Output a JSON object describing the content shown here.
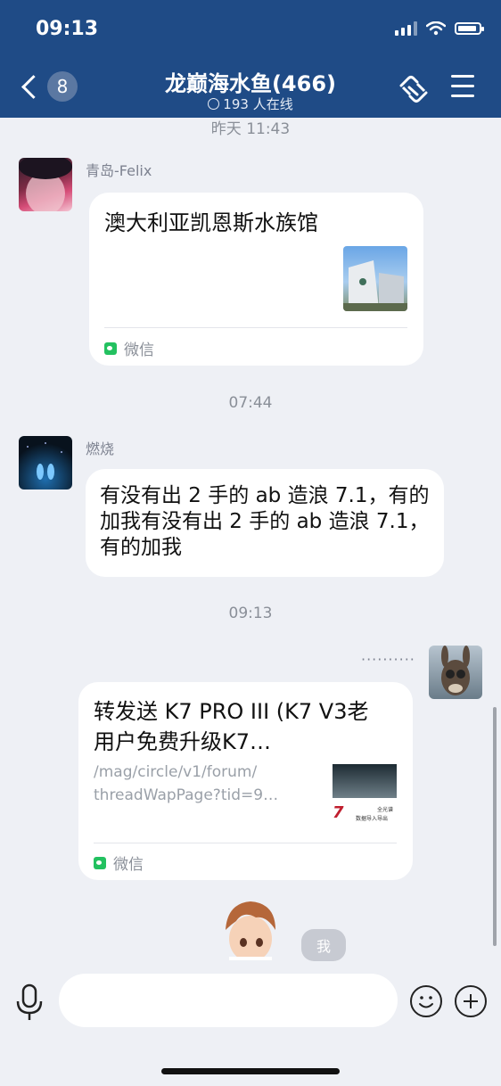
{
  "status_bar": {
    "time": "09:13"
  },
  "header": {
    "back_badge": "8",
    "title": "龙巅海水鱼(466)",
    "subtitle": "193 人在线"
  },
  "messages": {
    "ts1": "昨天 11:43",
    "m1": {
      "sender": "青岛-Felix",
      "card_title": "澳大利亚凯恩斯水族馆",
      "source": "微信"
    },
    "ts2": "07:44",
    "m2": {
      "sender": "燃烧",
      "lines": [
        "有没有出 2 手的 ab 造浪 7.1，有的",
        "加我有没有出 2 手的 ab 造浪 7.1，",
        "有的加我"
      ]
    },
    "ts3": "09:13",
    "m3": {
      "sender_dots": "··········",
      "card_title_lines": [
        "转发送 K7 PRO III (K7 V3老",
        "用户免费升级K7…"
      ],
      "url_lines": [
        "/mag/circle/v1/forum/",
        "threadWapPage?tid=9…"
      ],
      "thumb_text": [
        "7",
        "全光谱",
        "数据导入导出"
      ],
      "source": "微信"
    },
    "me_label": "我"
  },
  "colors": {
    "header_bg": "#1f4b86",
    "page_bg": "#eef0f5",
    "wechat_green": "#23c160"
  }
}
